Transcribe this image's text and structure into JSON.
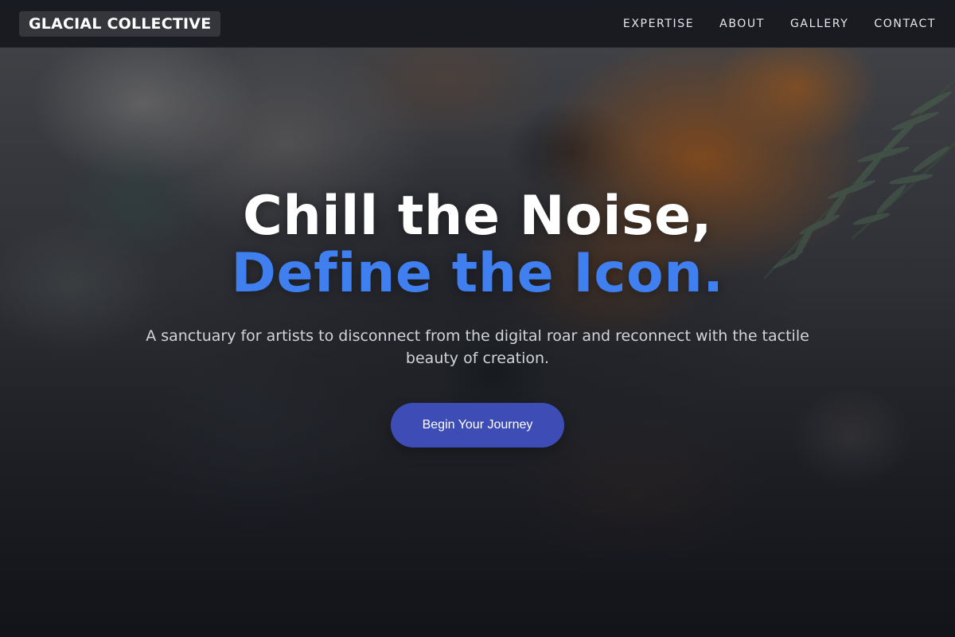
{
  "site": {
    "logo_text": "GLACIAL COLLECTIVE"
  },
  "nav": {
    "items": [
      {
        "label": "EXPERTISE"
      },
      {
        "label": "ABOUT"
      },
      {
        "label": "GALLERY"
      },
      {
        "label": "CONTACT"
      }
    ]
  },
  "hero": {
    "headline_line1": "Chill the Noise,",
    "headline_line2": "Define the Icon.",
    "subtitle": "A sanctuary for artists to disconnect from the digital roar and reconnect with the tactile beauty of creation.",
    "cta_label": "Begin Your Journey"
  },
  "colors": {
    "accent_text": "#3f7ff0",
    "cta_background": "#3d4db5",
    "nav_background": "#16181e"
  },
  "background": {
    "description_icon": "impasto-paint-texture-image"
  }
}
